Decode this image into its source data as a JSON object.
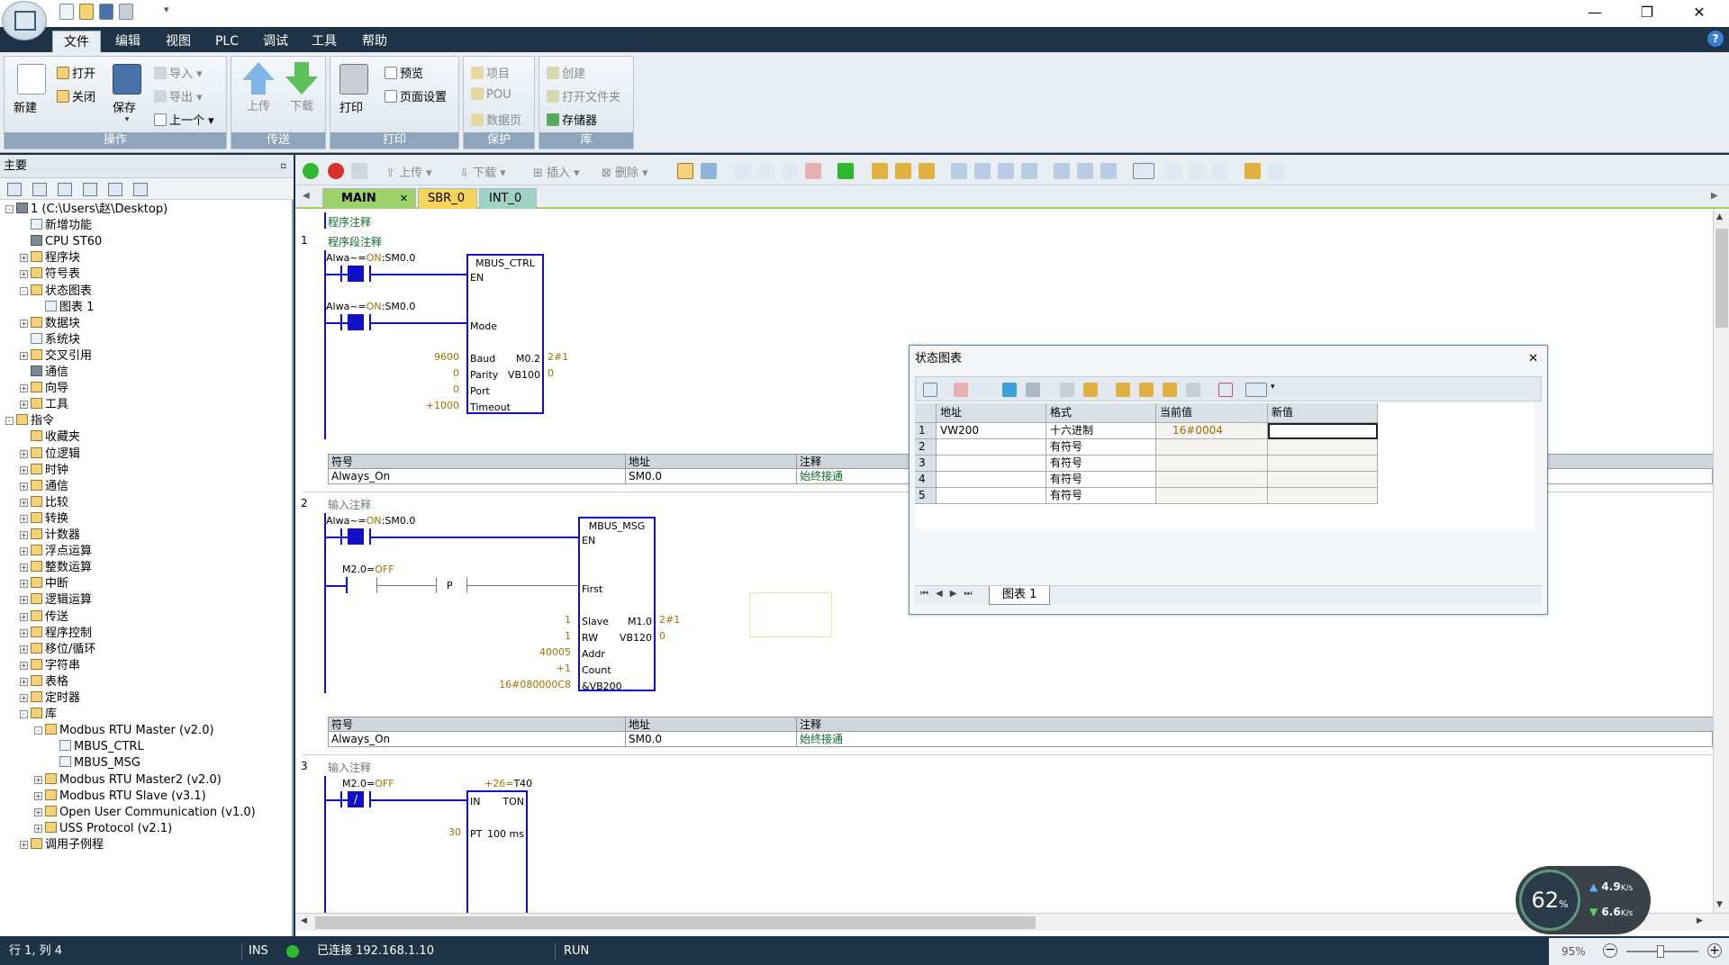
{
  "quick_access": [
    "new-icon",
    "open-icon",
    "save-icon",
    "print-icon"
  ],
  "window_controls": {
    "minimize": "—",
    "maximize": "❐",
    "close": "✕"
  },
  "menu": {
    "items": [
      "文件",
      "编辑",
      "视图",
      "PLC",
      "调试",
      "工具",
      "帮助"
    ],
    "active": "文件"
  },
  "ribbon": {
    "groups": [
      {
        "label": "操作",
        "buttons": {
          "new": "新建",
          "open": "打开",
          "close": "关闭",
          "save": "保存",
          "import": "导入",
          "export": "导出",
          "previous": "上一个"
        }
      },
      {
        "label": "传送",
        "buttons": {
          "upload": "上传",
          "download": "下载"
        }
      },
      {
        "label": "打印",
        "buttons": {
          "print": "打印",
          "preview": "预览",
          "page_setup": "页面设置"
        }
      },
      {
        "label": "保护",
        "buttons": {
          "project": "项目",
          "pou": "POU",
          "data_page": "数据页"
        }
      },
      {
        "label": "库",
        "buttons": {
          "create": "创建",
          "open_folder": "打开文件夹",
          "memory": "存储器"
        }
      }
    ]
  },
  "left_panel": {
    "title": "主要",
    "tree": [
      {
        "label": "1 (C:\\Users\\赵\\Desktop)",
        "level": 0,
        "exp": "-",
        "icon": "project"
      },
      {
        "label": "新增功能",
        "level": 1,
        "exp": "",
        "icon": "help"
      },
      {
        "label": "CPU ST60",
        "level": 1,
        "exp": "",
        "icon": "cpu"
      },
      {
        "label": "程序块",
        "level": 1,
        "exp": "+",
        "icon": "folder"
      },
      {
        "label": "符号表",
        "level": 1,
        "exp": "+",
        "icon": "folder"
      },
      {
        "label": "状态图表",
        "level": 1,
        "exp": "-",
        "icon": "folder"
      },
      {
        "label": "图表 1",
        "level": 2,
        "exp": "",
        "icon": "doc"
      },
      {
        "label": "数据块",
        "level": 1,
        "exp": "+",
        "icon": "folder"
      },
      {
        "label": "系统块",
        "level": 1,
        "exp": "",
        "icon": "doc"
      },
      {
        "label": "交叉引用",
        "level": 1,
        "exp": "+",
        "icon": "folder"
      },
      {
        "label": "通信",
        "level": 1,
        "exp": "",
        "icon": "pc"
      },
      {
        "label": "向导",
        "level": 1,
        "exp": "+",
        "icon": "folder"
      },
      {
        "label": "工具",
        "level": 1,
        "exp": "+",
        "icon": "folder"
      },
      {
        "label": "指令",
        "level": 0,
        "exp": "-",
        "icon": "folder"
      },
      {
        "label": "收藏夹",
        "level": 1,
        "exp": "",
        "icon": "folder"
      },
      {
        "label": "位逻辑",
        "level": 1,
        "exp": "+",
        "icon": "folder"
      },
      {
        "label": "时钟",
        "level": 1,
        "exp": "+",
        "icon": "folder"
      },
      {
        "label": "通信",
        "level": 1,
        "exp": "+",
        "icon": "folder"
      },
      {
        "label": "比较",
        "level": 1,
        "exp": "+",
        "icon": "folder"
      },
      {
        "label": "转换",
        "level": 1,
        "exp": "+",
        "icon": "folder"
      },
      {
        "label": "计数器",
        "level": 1,
        "exp": "+",
        "icon": "folder"
      },
      {
        "label": "浮点运算",
        "level": 1,
        "exp": "+",
        "icon": "folder"
      },
      {
        "label": "整数运算",
        "level": 1,
        "exp": "+",
        "icon": "folder"
      },
      {
        "label": "中断",
        "level": 1,
        "exp": "+",
        "icon": "folder"
      },
      {
        "label": "逻辑运算",
        "level": 1,
        "exp": "+",
        "icon": "folder"
      },
      {
        "label": "传送",
        "level": 1,
        "exp": "+",
        "icon": "folder"
      },
      {
        "label": "程序控制",
        "level": 1,
        "exp": "+",
        "icon": "folder"
      },
      {
        "label": "移位/循环",
        "level": 1,
        "exp": "+",
        "icon": "folder"
      },
      {
        "label": "字符串",
        "level": 1,
        "exp": "+",
        "icon": "folder"
      },
      {
        "label": "表格",
        "level": 1,
        "exp": "+",
        "icon": "folder"
      },
      {
        "label": "定时器",
        "level": 1,
        "exp": "+",
        "icon": "folder"
      },
      {
        "label": "库",
        "level": 1,
        "exp": "-",
        "icon": "folder"
      },
      {
        "label": "Modbus RTU Master (v2.0)",
        "level": 2,
        "exp": "-",
        "icon": "folder"
      },
      {
        "label": "MBUS_CTRL",
        "level": 3,
        "exp": "",
        "icon": "doc"
      },
      {
        "label": "MBUS_MSG",
        "level": 3,
        "exp": "",
        "icon": "doc"
      },
      {
        "label": "Modbus RTU Master2 (v2.0)",
        "level": 2,
        "exp": "+",
        "icon": "folder"
      },
      {
        "label": "Modbus RTU Slave (v3.1)",
        "level": 2,
        "exp": "+",
        "icon": "folder"
      },
      {
        "label": "Open User Communication (v1.0)",
        "level": 2,
        "exp": "+",
        "icon": "folder"
      },
      {
        "label": "USS Protocol (v2.1)",
        "level": 2,
        "exp": "+",
        "icon": "folder"
      },
      {
        "label": "调用子例程",
        "level": 1,
        "exp": "+",
        "icon": "folder"
      }
    ]
  },
  "editor_toolbar": {
    "upload": "上传",
    "download": "下载",
    "insert": "插入",
    "delete": "删除"
  },
  "tabs": [
    {
      "label": "MAIN",
      "close": "✕",
      "active": true
    },
    {
      "label": "SBR_0"
    },
    {
      "label": "INT_0"
    }
  ],
  "program_comment": "程序注释",
  "networks": [
    {
      "num": "1",
      "comment": "程序段注释",
      "c1": {
        "pre": "Alwa~=",
        "on": "ON",
        "post": ":SM0.0"
      },
      "c2": {
        "pre": "Alwa~=",
        "on": "ON",
        "post": ":SM0.0"
      },
      "box": {
        "title": "MBUS_CTRL",
        "en": "EN",
        "mode": "Mode",
        "baud": "Baud",
        "parity": "Parity",
        "port": "Port",
        "timeout": "Timeout",
        "out1": "M0.2",
        "out2": "VB100"
      },
      "vals": {
        "baud": "9600",
        "parity": "0",
        "port": "0",
        "timeout": "+1000",
        "out1": "2#1",
        "out2": "0"
      },
      "sym": {
        "h_sym": "符号",
        "h_addr": "地址",
        "h_cmt": "注释",
        "sym": "Always_On",
        "addr": "SM0.0",
        "cmt": "始终接通"
      }
    },
    {
      "num": "2",
      "comment": "输入注释",
      "c1": {
        "pre": "Alwa~=",
        "on": "ON",
        "post": ":SM0.0"
      },
      "c2": {
        "pre": "M2.0=",
        "on": "OFF"
      },
      "p": "P",
      "box": {
        "title": "MBUS_MSG",
        "en": "EN",
        "first": "First",
        "slave": "Slave",
        "rw": "RW",
        "addr": "Addr",
        "count": "Count",
        "data": "&VB200",
        "out1": "M1.0",
        "out2": "VB120"
      },
      "vals": {
        "slave": "1",
        "rw": "1",
        "addr": "40005",
        "count": "+1",
        "data": "16#080000C8",
        "out1": "2#1",
        "out2": "0"
      },
      "sym": {
        "h_sym": "符号",
        "h_addr": "地址",
        "h_cmt": "注释",
        "sym": "Always_On",
        "addr": "SM0.0",
        "cmt": "始终接通"
      }
    },
    {
      "num": "3",
      "comment": "输入注释",
      "c1": {
        "pre": "M2.0=",
        "on": "OFF",
        "inner": "/"
      },
      "box": {
        "title": "TON",
        "pre": "+26=",
        "name": "T40",
        "in": "IN",
        "pt": "PT",
        "res": "100 ms"
      },
      "vals": {
        "pt": "30"
      }
    }
  ],
  "status_chart": {
    "title": "状态图表",
    "close": "✕",
    "headers": [
      "地址",
      "格式",
      "当前值",
      "新值"
    ],
    "rows": [
      {
        "n": "1",
        "addr": "VW200",
        "fmt": "十六进制",
        "cur": "16#0004",
        "new": ""
      },
      {
        "n": "2",
        "addr": "",
        "fmt": "有符号",
        "cur": "",
        "new": ""
      },
      {
        "n": "3",
        "addr": "",
        "fmt": "有符号",
        "cur": "",
        "new": ""
      },
      {
        "n": "4",
        "addr": "",
        "fmt": "有符号",
        "cur": "",
        "new": ""
      },
      {
        "n": "5",
        "addr": "",
        "fmt": "有符号",
        "cur": "",
        "new": ""
      }
    ],
    "sheet_tab": "图表 1"
  },
  "statusbar": {
    "pos": "行 1, 列 4",
    "mode": "INS",
    "conn": "已连接 192.168.1.10",
    "run": "RUN",
    "zoom": "95%"
  },
  "netmon": {
    "pct": "62",
    "unit": "%",
    "up": "4.9",
    "down": "6.6",
    "rate": "K/s"
  },
  "colors": {
    "accent": "#1f3346",
    "wire": "#1010c8",
    "green": "#2fb82f"
  }
}
